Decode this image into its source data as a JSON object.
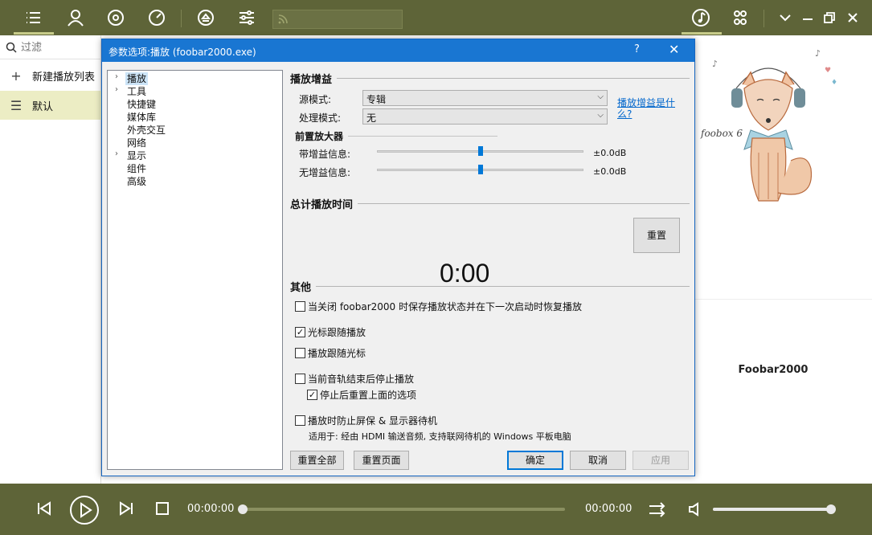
{
  "topbar": {
    "icons": [
      "list-icon",
      "user-icon",
      "disc-icon",
      "gauge-icon",
      "eject-icon",
      "equalizer-icon"
    ],
    "right_icons": [
      "music-note-icon",
      "grid-icon"
    ]
  },
  "sidebar": {
    "filter_placeholder": "过滤",
    "new_playlist": "新建播放列表",
    "default_playlist": "默认"
  },
  "art": {
    "caption": "foobox 6",
    "title": "Foobar2000"
  },
  "player": {
    "time_elapsed": "00:00:00",
    "time_total": "00:00:00",
    "progress": 0,
    "volume": 1.0
  },
  "dialog": {
    "title": "参数选项:播放 (foobar2000.exe)",
    "help": "?",
    "close": "✕",
    "tree": [
      {
        "label": "播放",
        "expandable": true,
        "selected": true
      },
      {
        "label": "工具",
        "expandable": true
      },
      {
        "label": "快捷键"
      },
      {
        "label": "媒体库"
      },
      {
        "label": "外壳交互"
      },
      {
        "label": "网络"
      },
      {
        "label": "显示",
        "expandable": true
      },
      {
        "label": "组件"
      },
      {
        "label": "高级"
      }
    ],
    "replaygain": {
      "heading": "播放增益",
      "source_label": "源模式:",
      "source_value": "专辑",
      "process_label": "处理模式:",
      "process_value": "无",
      "help_link": "播放增益是什么?",
      "preamp_heading": "前置放大器",
      "with_rg_label": "带增益信息:",
      "with_rg_value": "±0.0dB",
      "without_rg_label": "无增益信息:",
      "without_rg_value": "±0.0dB",
      "with_rg_level": 0.5,
      "without_rg_level": 0.5
    },
    "total_time": {
      "heading": "总计播放时间",
      "value": "0:00",
      "reset": "重置"
    },
    "other": {
      "heading": "其他",
      "options": [
        {
          "label": "当关闭 foobar2000 时保存播放状态并在下一次启动时恢复播放",
          "checked": false
        },
        {
          "label": "光标跟随播放",
          "checked": true
        },
        {
          "label": "播放跟随光标",
          "checked": false
        },
        {
          "label": "当前音轨结束后停止播放",
          "checked": false
        },
        {
          "label": "停止后重置上面的选项",
          "checked": true
        },
        {
          "label": "播放时防止屏保 & 显示器待机",
          "checked": false
        }
      ],
      "note": "适用于: 经由 HDMI 输送音频, 支持联网待机的 Windows 平板电脑"
    },
    "buttons": {
      "reset_all": "重置全部",
      "reset_page": "重置页面",
      "ok": "确定",
      "cancel": "取消",
      "apply": "应用"
    }
  }
}
